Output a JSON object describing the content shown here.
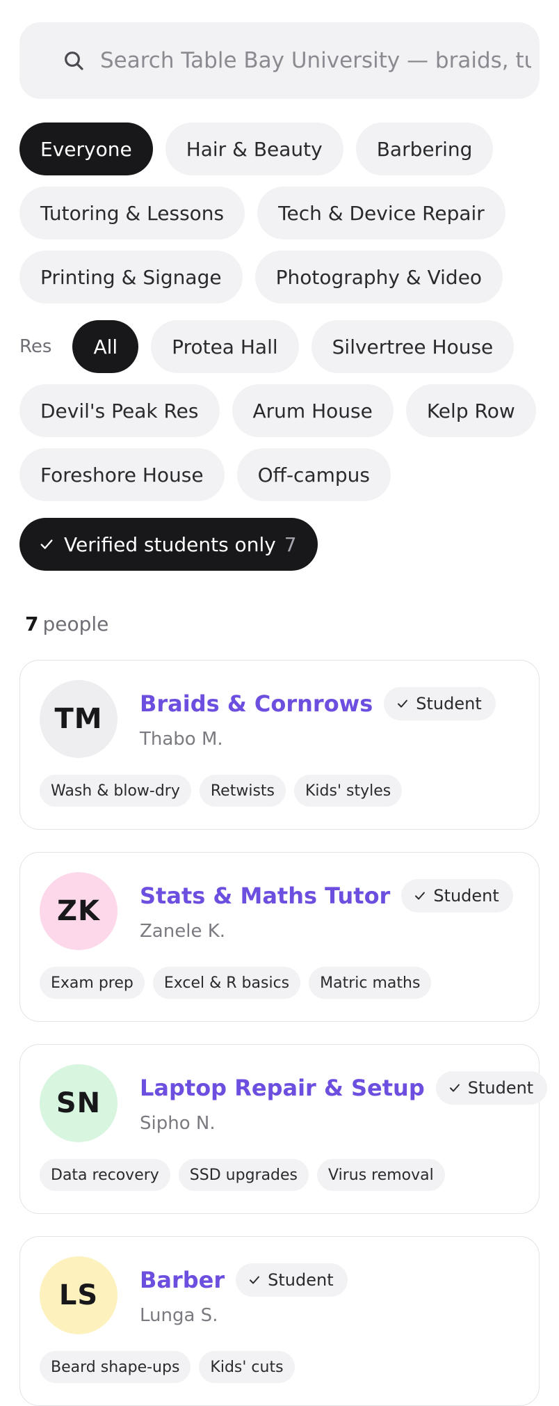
{
  "search": {
    "placeholder": "Search Table Bay University — braids, tuto",
    "icon": "search-icon"
  },
  "categories": [
    "Everyone",
    "Hair & Beauty",
    "Barbering",
    "Tutoring & Lessons",
    "Tech & Device Repair",
    "Printing & Signage",
    "Photography & Video"
  ],
  "categories_selected": "Everyone",
  "residence": {
    "label": "Res",
    "options": [
      "All",
      "Protea Hall",
      "Silvertree House",
      "Devil's Peak Res",
      "Arum House",
      "Kelp Row",
      "Foreshore House",
      "Off-campus"
    ],
    "selected": "All"
  },
  "verified_filter": {
    "label": "Verified students only",
    "count": "7",
    "icon": "check-icon"
  },
  "results": {
    "count": "7",
    "suffix": "people"
  },
  "colors": {
    "accent": "#6d4fe0",
    "chip_active_bg": "#18181b",
    "chip_bg": "#f2f2f4"
  },
  "listings": [
    {
      "initials": "TM",
      "avatar_color": "#eeeef0",
      "title": "Braids & Cornrows",
      "badge": "Student",
      "owner": "Thabo M.",
      "tags": [
        "Wash & blow-dry",
        "Retwists",
        "Kids' styles"
      ]
    },
    {
      "initials": "ZK",
      "avatar_color": "#fdd7ea",
      "title": "Stats & Maths Tutor",
      "badge": "Student",
      "owner": "Zanele K.",
      "tags": [
        "Exam prep",
        "Excel & R basics",
        "Matric maths"
      ]
    },
    {
      "initials": "SN",
      "avatar_color": "#d8f5e0",
      "title": "Laptop Repair & Setup",
      "badge": "Student",
      "owner": "Sipho N.",
      "tags": [
        "Data recovery",
        "SSD upgrades",
        "Virus removal"
      ]
    },
    {
      "initials": "LS",
      "avatar_color": "#fdf1bd",
      "title": "Barber",
      "badge": "Student",
      "owner": "Lunga S.",
      "tags": [
        "Beard shape-ups",
        "Kids' cuts"
      ]
    }
  ]
}
